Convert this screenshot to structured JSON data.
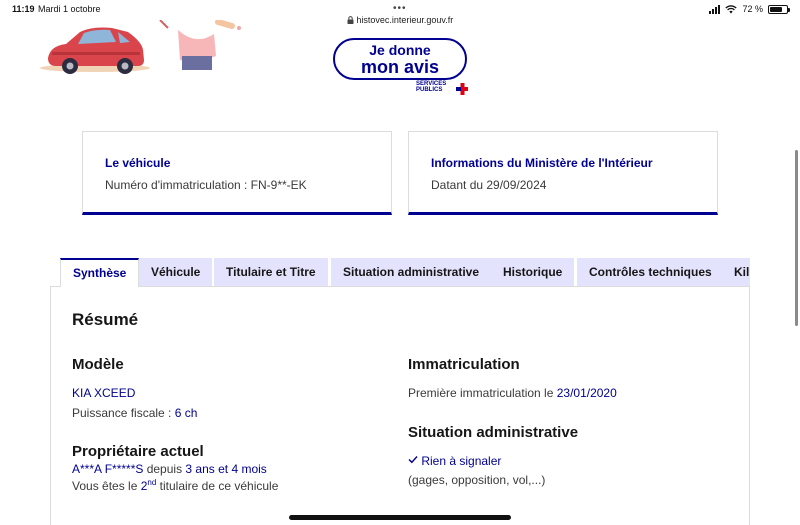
{
  "status_bar": {
    "time": "11:19",
    "date": "Mardi 1 octobre",
    "url": "histovec.interieur.gouv.fr",
    "battery": "72 %",
    "battery_fraction": 0.72
  },
  "avis_button": {
    "line1": "Je donne",
    "line2": "mon avis"
  },
  "services_publics": {
    "line1": "SERVICES",
    "line2": "PUBLICS"
  },
  "cards": {
    "vehicle": {
      "title": "Le véhicule",
      "text": "Numéro d'immatriculation : FN-9**-EK"
    },
    "ministry": {
      "title": "Informations du Ministère de l'Intérieur",
      "text": "Datant du 29/09/2024"
    }
  },
  "tabs": [
    {
      "label": "Synthèse",
      "active": true
    },
    {
      "label": "Véhicule",
      "active": false
    },
    {
      "label": "Titulaire et Titre",
      "active": false
    },
    {
      "label": "Situation administrative",
      "active": false
    },
    {
      "label": "Historique",
      "active": false
    },
    {
      "label": "Contrôles techniques",
      "active": false
    },
    {
      "label": "Kil",
      "active": false
    }
  ],
  "summary": {
    "heading": "Résumé",
    "model": {
      "heading": "Modèle",
      "name": "KIA XCEED",
      "power_label": "Puissance fiscale : ",
      "power_value": "6 ch"
    },
    "owner": {
      "heading": "Propriétaire actuel",
      "name": "A***A F*****S",
      "since_word": " depuis ",
      "duration": "3 ans et 4 mois",
      "rank_prefix": "Vous êtes le ",
      "rank_num": "2",
      "rank_sup": "nd",
      "rank_suffix": " titulaire de ce véhicule"
    },
    "registration": {
      "heading": "Immatriculation",
      "label": "Première immatriculation le ",
      "date": "23/01/2020"
    },
    "admin": {
      "heading": "Situation administrative",
      "status": "Rien à signaler",
      "detail": "(gages, opposition, vol,...)"
    }
  },
  "colors": {
    "primary": "#000091",
    "tab_bg": "#e3e3fd",
    "text": "#3a3a3a",
    "marianne_red": "#e1000f"
  }
}
